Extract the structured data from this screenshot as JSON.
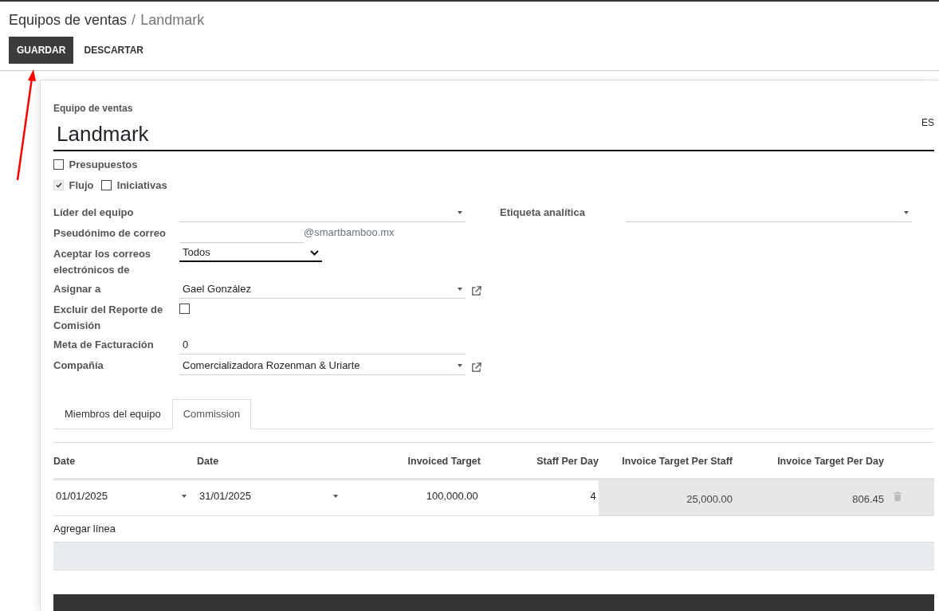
{
  "breadcrumb": [
    {
      "text": "Equipos de ventas"
    },
    {
      "text": "Landmark"
    }
  ],
  "breadcrumb_separator": "/",
  "buttons": [
    {
      "label": "GUARDAR",
      "kind": "primary"
    },
    {
      "label": "DESCARTAR",
      "kind": "secondary"
    }
  ],
  "record": {
    "name_label": "Equipo de ventas",
    "name": "Landmark",
    "language": "ES"
  },
  "option_rows": [
    [
      {
        "label": "Presupuestos",
        "checked": false,
        "disabled": false
      }
    ],
    [
      {
        "label": "Flujo",
        "checked": true,
        "disabled": true
      },
      {
        "label": "Iniciativas",
        "checked": false,
        "disabled": false
      }
    ]
  ],
  "fields_left": [
    {
      "label": "Líder del equipo",
      "kind": "many2one",
      "external_link": false
    },
    {
      "label": "Pseudónimo de correo",
      "kind": "alias",
      "suffix": "@smartbamboo.mx"
    },
    {
      "label": "Aceptar los correos electrónicos de",
      "kind": "select",
      "value": "Todos"
    },
    {
      "label": "Asignar a",
      "kind": "many2one",
      "value": "Gael González",
      "external_link": true
    },
    {
      "label": "Excluir del Reporte de Comisión",
      "kind": "checkbox",
      "checked": false
    },
    {
      "label": "Meta de Facturación",
      "kind": "text",
      "value": "0"
    },
    {
      "label": "Compañía",
      "kind": "many2one",
      "value": "Comercializadora Rozenman & Uriarte",
      "external_link": true
    }
  ],
  "fields_right": [
    {
      "label": "Etiqueta analítica",
      "external_link": false
    }
  ],
  "tabs": [
    {
      "label": "Miembros del equipo",
      "selected": false
    },
    {
      "label": "Commission",
      "selected": true
    }
  ],
  "table": {
    "columns": [
      {
        "label": "Date"
      },
      {
        "label": "Date"
      },
      {
        "label": "Invoiced Target"
      },
      {
        "label": "Staff Per Day"
      },
      {
        "label": "Invoice Target Per Staff"
      },
      {
        "label": "Invoice Target Per Day"
      }
    ],
    "rows": [
      {
        "deletable": true,
        "cells": [
          {
            "text": "01/01/2025",
            "kind": "date"
          },
          {
            "text": "31/01/2025",
            "kind": "date"
          },
          {
            "text": "100,000.00",
            "kind": "number"
          },
          {
            "text": "4",
            "kind": "number"
          },
          {
            "text": "25,000.00",
            "kind": "readonly"
          },
          {
            "text": "806.45",
            "kind": "readonly"
          }
        ]
      }
    ],
    "add_line": "Agregar línea"
  }
}
